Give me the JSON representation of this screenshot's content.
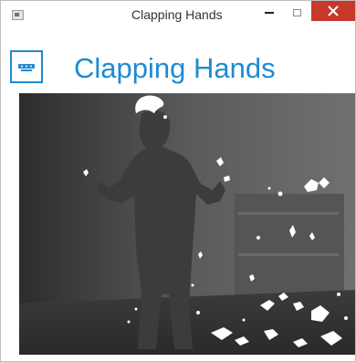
{
  "window": {
    "title": "Clapping Hands",
    "app_icon": "window-app-icon",
    "controls": {
      "minimize_icon": "minimize-icon",
      "maximize_icon": "maximize-icon",
      "close_icon": "close-icon",
      "close_color": "#c7392b"
    }
  },
  "header": {
    "title": "Clapping Hands",
    "icon": "kinect-sensor-icon",
    "accent_color": "#1e8bd1"
  },
  "depth_view": {
    "content": "depth-camera-image"
  }
}
